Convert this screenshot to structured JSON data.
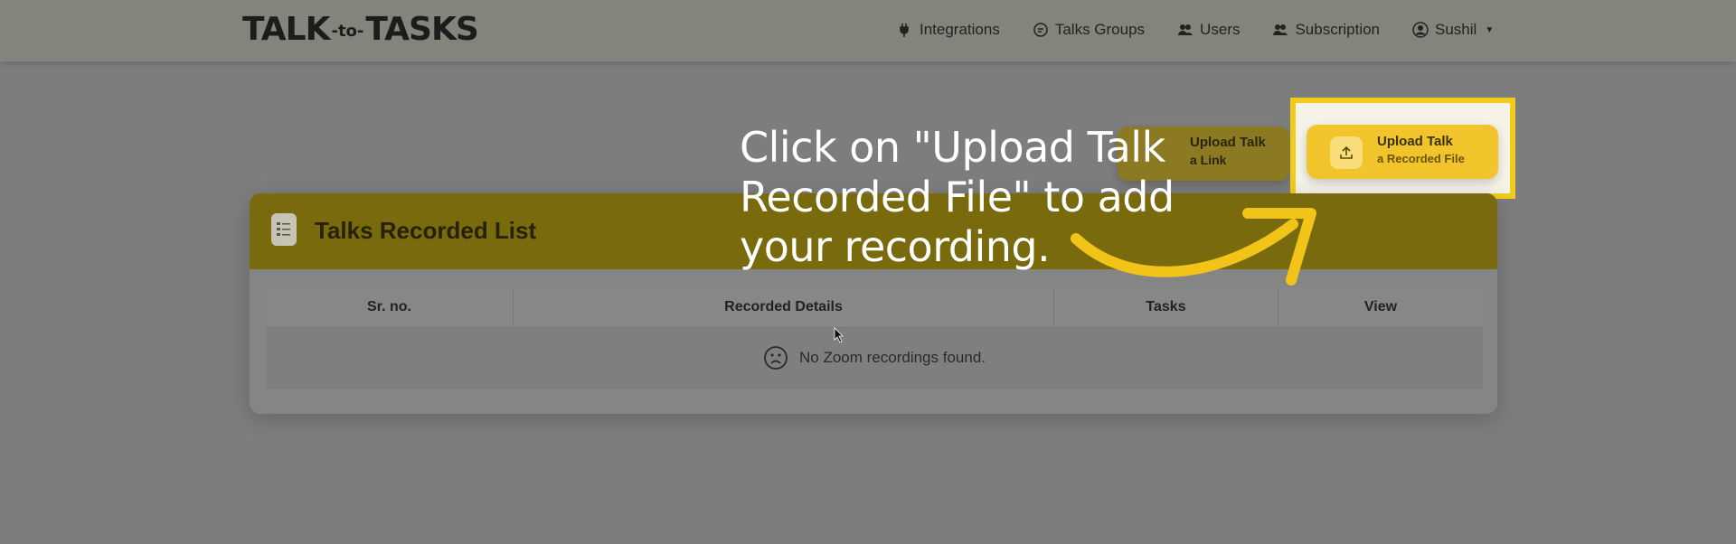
{
  "navbar": {
    "logo": {
      "part1": "TALK",
      "part2": "-to-",
      "part3": "TASKS"
    },
    "links": [
      {
        "label": "Integrations",
        "icon": "plug-icon"
      },
      {
        "label": "Talks Groups",
        "icon": "chat-icon"
      },
      {
        "label": "Users",
        "icon": "users-icon"
      },
      {
        "label": "Subscription",
        "icon": "subscription-icon"
      }
    ],
    "user": {
      "label": "Sushil",
      "icon": "user-circle-icon"
    }
  },
  "actions": {
    "upload_link": {
      "line1": "Upload Talk",
      "line2": "a Link"
    },
    "upload_file": {
      "line1": "Upload Talk",
      "line2": "a Recorded File",
      "icon": "upload-icon"
    }
  },
  "card": {
    "title": "Talks Recorded List",
    "columns": [
      "Sr. no.",
      "Recorded Details",
      "Tasks",
      "View"
    ],
    "empty_message": "No Zoom recordings found."
  },
  "annotation": {
    "text": "Click on \"Upload Talk Recorded File\" to add your recording."
  },
  "colors": {
    "accent": "#f2cc1a",
    "header": "#786a0d",
    "button": "#f2c42b"
  }
}
